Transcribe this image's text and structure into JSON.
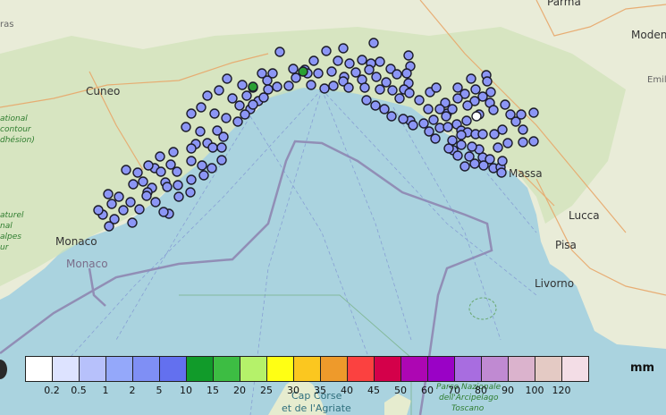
{
  "map": {
    "places": {
      "parma": "Parma",
      "modena": "Modena",
      "cuneo": "Cuneo",
      "monaco_city": "Monaco",
      "monaco_country": "Monaco",
      "massa": "Massa",
      "lucca": "Lucca",
      "pisa": "Pisa",
      "livorno": "Livorno",
      "cap_corse_1": "Cap Corse",
      "cap_corse_2": "et de l'Agriate",
      "archipelago_1": "Parco Nazionale",
      "archipelago_2": "dell'Arcipelago",
      "archipelago_3": "Toscano",
      "fragment_ras": "ras",
      "fragment_emil": "Emil",
      "park_left_1": "ational",
      "park_left_2": "contour",
      "park_left_3": "dhésion)",
      "park_bottom_1": "aturel",
      "park_bottom_2": "nal",
      "park_bottom_3": "alpes",
      "park_bottom_4": "ur"
    },
    "station_colors": {
      "default": "#8c96f5",
      "green": "#2aa033",
      "white": "#ffffff"
    }
  },
  "legend": {
    "unit": "mm",
    "colors": [
      "#ffffff",
      "#dde3ff",
      "#b7c1fb",
      "#94a8fa",
      "#7f8ff5",
      "#6370ef",
      "#119b2a",
      "#3dbd43",
      "#b5f26a",
      "#ffff14",
      "#fbc71f",
      "#ee9a2b",
      "#fb4140",
      "#d4004a",
      "#ad06b3",
      "#9a02c6",
      "#a86de0",
      "#c08ad2",
      "#dbb3cd",
      "#e4cac4",
      "#f3dde6"
    ],
    "ticks": [
      "0.2",
      "0.5",
      "1",
      "2",
      "5",
      "10",
      "15",
      "20",
      "25",
      "30",
      "35",
      "40",
      "45",
      "50",
      "60",
      "70",
      "80",
      "90",
      "100",
      "120"
    ]
  }
}
